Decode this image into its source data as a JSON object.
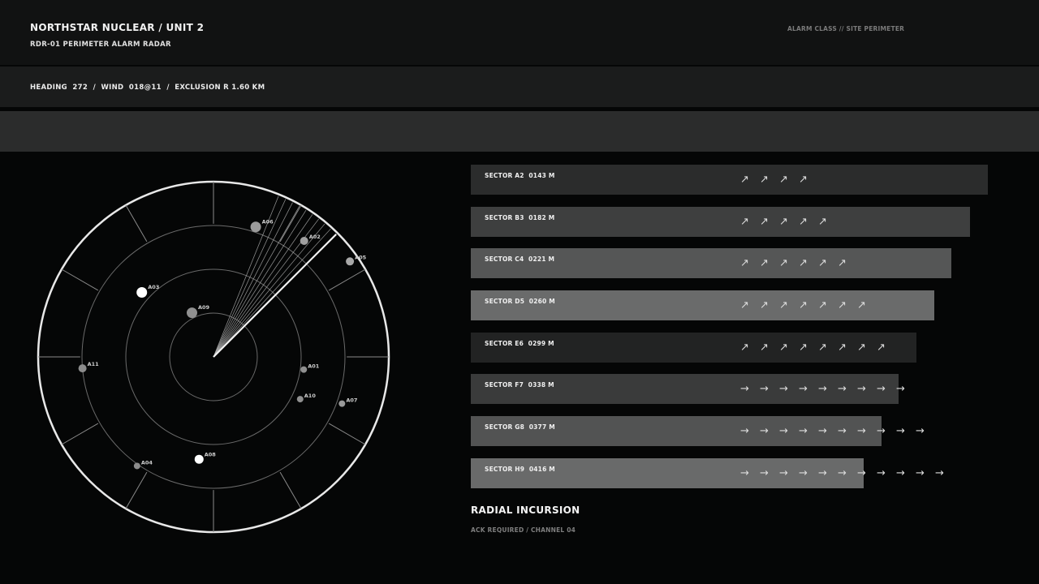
{
  "header": {
    "title": "NORTHSTAR NUCLEAR / UNIT 2",
    "subtitle": "RDR-01  PERIMETER ALARM RADAR",
    "alarm_class": "ALARM CLASS // SITE PERIMETER"
  },
  "info": {
    "text": "HEADING  272  /  WIND  018@11  /  EXCLUSION R 1.60 KM"
  },
  "radar": {
    "blips": [
      {
        "id": "A06",
        "angle": 18,
        "dist": 0.78,
        "tone": "#9a9a9a",
        "size": 6.5
      },
      {
        "id": "A02",
        "angle": 38,
        "dist": 0.84,
        "tone": "#a0a0a0",
        "size": 5
      },
      {
        "id": "A05",
        "angle": 55,
        "dist": 0.95,
        "tone": "#a8a8a8",
        "size": 5
      },
      {
        "id": "A03",
        "angle": -48,
        "dist": 0.55,
        "tone": "#ffffff",
        "size": 6.5
      },
      {
        "id": "A09",
        "angle": -26,
        "dist": 0.28,
        "tone": "#909090",
        "size": 6.5
      },
      {
        "id": "A11",
        "angle": -95,
        "dist": 0.75,
        "tone": "#8c8c8c",
        "size": 5
      },
      {
        "id": "A01",
        "angle": 98,
        "dist": 0.52,
        "tone": "#909090",
        "size": 4
      },
      {
        "id": "A10",
        "angle": 116,
        "dist": 0.55,
        "tone": "#909090",
        "size": 4
      },
      {
        "id": "A07",
        "angle": 110,
        "dist": 0.78,
        "tone": "#9a9a9a",
        "size": 4
      },
      {
        "id": "A08",
        "angle": 188,
        "dist": 0.59,
        "tone": "#ffffff",
        "size": 5.5
      },
      {
        "id": "A04",
        "angle": 215,
        "dist": 0.76,
        "tone": "#8c8c8c",
        "size": 4
      }
    ]
  },
  "sectors": [
    {
      "label": "SECTOR A2  0143 M",
      "fill": "#2b2c2c",
      "bar_fraction": 1.0,
      "arrow_count": 4,
      "arrow": "↗"
    },
    {
      "label": "SECTOR B3  0182 M",
      "fill": "#3e3f3f",
      "bar_fraction": 0.965,
      "arrow_count": 5,
      "arrow": "↗"
    },
    {
      "label": "SECTOR C4  0221 M",
      "fill": "#555656",
      "bar_fraction": 0.93,
      "arrow_count": 6,
      "arrow": "↗"
    },
    {
      "label": "SECTOR D5  0260 M",
      "fill": "#6a6b6b",
      "bar_fraction": 0.897,
      "arrow_count": 7,
      "arrow": "↗"
    },
    {
      "label": "SECTOR E6  0299 M",
      "fill": "#222323",
      "bar_fraction": 0.862,
      "arrow_count": 8,
      "arrow": "↗"
    },
    {
      "label": "SECTOR F7  0338 M",
      "fill": "#3a3b3b",
      "bar_fraction": 0.828,
      "arrow_count": 9,
      "arrow": "→"
    },
    {
      "label": "SECTOR G8  0377 M",
      "fill": "#525353",
      "bar_fraction": 0.794,
      "arrow_count": 10,
      "arrow": "→"
    },
    {
      "label": "SECTOR H9  0416 M",
      "fill": "#696a6a",
      "bar_fraction": 0.76,
      "arrow_count": 11,
      "arrow": "→"
    }
  ],
  "status": {
    "title": "RADIAL INCURSION",
    "subtitle": "ACK REQUIRED / CHANNEL 04"
  }
}
